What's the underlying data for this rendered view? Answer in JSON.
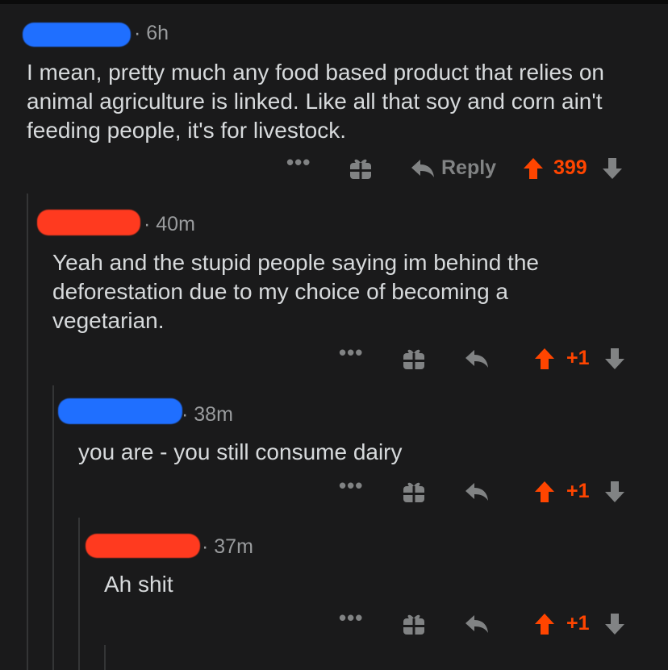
{
  "comments": [
    {
      "time": "6h",
      "text": "I mean, pretty much any food based product that relies on animal agriculture is linked. Like all that soy and corn ain't feeding people, it's for livestock.",
      "reply_label": "Reply",
      "score": "399",
      "redaction_color": "#1f6fff"
    },
    {
      "time": "40m",
      "text": "Yeah and the stupid people saying im behind the deforestation due to my choice of becoming a vegetarian.",
      "score": "+1",
      "redaction_color": "#ff3a1f"
    },
    {
      "time": "38m",
      "text": "you are - you still consume dairy",
      "score": "+1",
      "redaction_color": "#1f6fff"
    },
    {
      "time": "37m",
      "text": "Ah shit",
      "score": "+1",
      "redaction_color": "#ff3a1f"
    }
  ],
  "actions": {
    "more_icon": "more-dots-icon",
    "award_icon": "gift-award-icon",
    "reply_icon": "reply-arrow-icon",
    "upvote_icon": "upvote-arrow-icon",
    "downvote_icon": "downvote-arrow-icon",
    "more_label": "•••"
  },
  "colors": {
    "background": "#1a1a1b",
    "text": "#d7dadc",
    "meta": "#9a9c9e",
    "upvote": "#ff4500",
    "icon": "#818384"
  }
}
